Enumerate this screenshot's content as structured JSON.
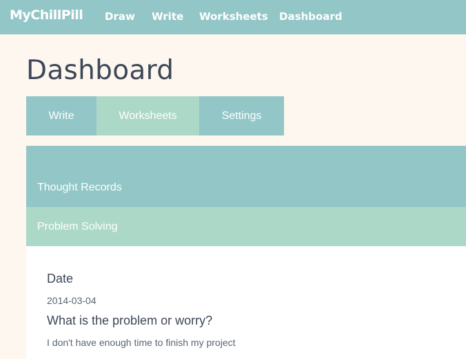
{
  "topnav": {
    "logo": "MyChillPill",
    "links": [
      "Draw",
      "Write",
      "Worksheets",
      "Dashboard"
    ]
  },
  "page": {
    "title": "Dashboard"
  },
  "tabs": [
    "Write",
    "Worksheets",
    "Settings"
  ],
  "worksheets": {
    "items": [
      "Thought Records",
      "Problem Solving"
    ],
    "active": "Problem Solving"
  },
  "form": {
    "date_label": "Date",
    "date_value": "2014-03-04",
    "problem_label": "What is the problem or worry?",
    "problem_value": "I don't have enough time to finish my project"
  },
  "colors": {
    "nav_bg": "#93c6c7",
    "active_bg": "#acd8c7",
    "page_bg": "#fdf7f0",
    "title": "#3d4756"
  }
}
